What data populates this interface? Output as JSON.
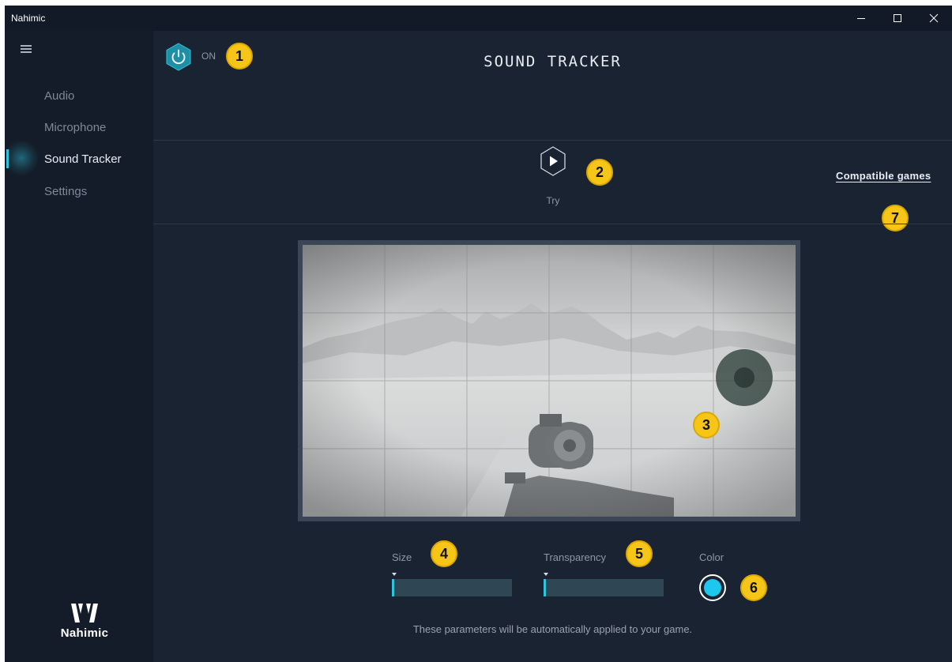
{
  "window": {
    "title": "Nahimic",
    "controls": [
      "minimize-icon",
      "maximize-icon",
      "close-icon"
    ]
  },
  "sidebar": {
    "menu_icon": "hamburger-menu-icon",
    "items": [
      {
        "label": "Audio",
        "active": false
      },
      {
        "label": "Microphone",
        "active": false
      },
      {
        "label": "Sound Tracker",
        "active": true
      },
      {
        "label": "Settings",
        "active": false
      }
    ],
    "logo_text": "Nahimic"
  },
  "header": {
    "power_state": "ON",
    "title": "SOUND TRACKER"
  },
  "try": {
    "label": "Try"
  },
  "compatible_games_link": "Compatible games",
  "controls": {
    "size_label": "Size",
    "size_value": 0.02,
    "transparency_label": "Transparency",
    "transparency_value": 0.02,
    "color_label": "Color",
    "color_value": "#1cc8ee"
  },
  "footnote": "These parameters will be automatically applied to your game.",
  "callouts": [
    "1",
    "2",
    "3",
    "4",
    "5",
    "6",
    "7"
  ],
  "colors": {
    "background": "#1a2332",
    "sidebar": "#141c29",
    "accent": "#2ec4dd",
    "callout": "#f5c518"
  }
}
